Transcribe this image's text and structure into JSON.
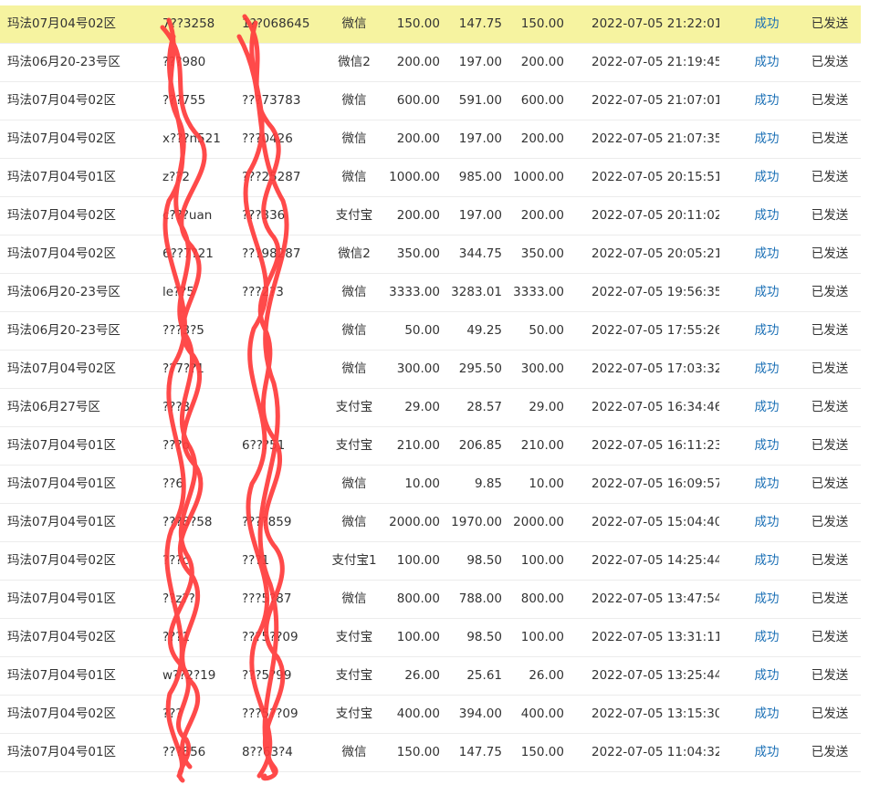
{
  "rows": [
    {
      "zone": "玛法07月04号02区",
      "user": "7??3258",
      "order": "1??068645",
      "pay": "微信",
      "amount": "150.00",
      "net": "147.75",
      "credit": "150.00",
      "time": "2022-07-05 21:22:01",
      "status": "成功",
      "sent": "已发送",
      "highlight": true
    },
    {
      "zone": "玛法06月20-23号区",
      "user": "???980",
      "order": "",
      "pay": "微信2",
      "amount": "200.00",
      "net": "197.00",
      "credit": "200.00",
      "time": "2022-07-05 21:19:45",
      "status": "成功",
      "sent": "已发送",
      "highlight": false
    },
    {
      "zone": "玛法07月04号02区",
      "user": "???755",
      "order": "???73783",
      "pay": "微信",
      "amount": "600.00",
      "net": "591.00",
      "credit": "600.00",
      "time": "2022-07-05 21:07:01",
      "status": "成功",
      "sent": "已发送",
      "highlight": false
    },
    {
      "zone": "玛法07月04号02区",
      "user": "x???n521",
      "order": "???0426",
      "pay": "微信",
      "amount": "200.00",
      "net": "197.00",
      "credit": "200.00",
      "time": "2022-07-05 21:07:35",
      "status": "成功",
      "sent": "已发送",
      "highlight": false
    },
    {
      "zone": "玛法07月04号01区",
      "user": "z??2",
      "order": "???25287",
      "pay": "微信",
      "amount": "1000.00",
      "net": "985.00",
      "credit": "1000.00",
      "time": "2022-07-05 20:15:51",
      "status": "成功",
      "sent": "已发送",
      "highlight": false
    },
    {
      "zone": "玛法07月04号02区",
      "user": "c???uan",
      "order": "???336",
      "pay": "支付宝",
      "amount": "200.00",
      "net": "197.00",
      "credit": "200.00",
      "time": "2022-07-05 20:11:02",
      "status": "成功",
      "sent": "已发送",
      "highlight": false
    },
    {
      "zone": "玛法07月04号02区",
      "user": "6??7?21",
      "order": "???98287",
      "pay": "微信2",
      "amount": "350.00",
      "net": "344.75",
      "credit": "350.00",
      "time": "2022-07-05 20:05:21",
      "status": "成功",
      "sent": "已发送",
      "highlight": false
    },
    {
      "zone": "玛法06月20-23号区",
      "user": "le??5",
      "order": "???2?3",
      "pay": "微信",
      "amount": "3333.00",
      "net": "3283.01",
      "credit": "3333.00",
      "time": "2022-07-05 19:56:35",
      "status": "成功",
      "sent": "已发送",
      "highlight": false
    },
    {
      "zone": "玛法06月20-23号区",
      "user": "???3?5",
      "order": "",
      "pay": "微信",
      "amount": "50.00",
      "net": "49.25",
      "credit": "50.00",
      "time": "2022-07-05 17:55:26",
      "status": "成功",
      "sent": "已发送",
      "highlight": false
    },
    {
      "zone": "玛法07月04号02区",
      "user": "??7??1",
      "order": "",
      "pay": "微信",
      "amount": "300.00",
      "net": "295.50",
      "credit": "300.00",
      "time": "2022-07-05 17:03:32",
      "status": "成功",
      "sent": "已发送",
      "highlight": false
    },
    {
      "zone": "玛法06月27号区",
      "user": "???3",
      "order": "",
      "pay": "支付宝",
      "amount": "29.00",
      "net": "28.57",
      "credit": "29.00",
      "time": "2022-07-05 16:34:46",
      "status": "成功",
      "sent": "已发送",
      "highlight": false
    },
    {
      "zone": "玛法07月04号01区",
      "user": "???o",
      "order": "6???51",
      "pay": "支付宝",
      "amount": "210.00",
      "net": "206.85",
      "credit": "210.00",
      "time": "2022-07-05 16:11:23",
      "status": "成功",
      "sent": "已发送",
      "highlight": false
    },
    {
      "zone": "玛法07月04号01区",
      "user": "??6",
      "order": "",
      "pay": "微信",
      "amount": "10.00",
      "net": "9.85",
      "credit": "10.00",
      "time": "2022-07-05 16:09:57",
      "status": "成功",
      "sent": "已发送",
      "highlight": false
    },
    {
      "zone": "玛法07月04号01区",
      "user": "???8?58",
      "order": "????859",
      "pay": "微信",
      "amount": "2000.00",
      "net": "1970.00",
      "credit": "2000.00",
      "time": "2022-07-05 15:04:40",
      "status": "成功",
      "sent": "已发送",
      "highlight": false
    },
    {
      "zone": "玛法07月04号02区",
      "user": "???c",
      "order": "???1",
      "pay": "支付宝1",
      "amount": "100.00",
      "net": "98.50",
      "credit": "100.00",
      "time": "2022-07-05 14:25:44",
      "status": "成功",
      "sent": "已发送",
      "highlight": false
    },
    {
      "zone": "玛法07月04号01区",
      "user": "??z??",
      "order": "???5?87",
      "pay": "微信",
      "amount": "800.00",
      "net": "788.00",
      "credit": "800.00",
      "time": "2022-07-05 13:47:54",
      "status": "成功",
      "sent": "已发送",
      "highlight": false
    },
    {
      "zone": "玛法07月04号02区",
      "user": "???1",
      "order": "???5??09",
      "pay": "支付宝",
      "amount": "100.00",
      "net": "98.50",
      "credit": "100.00",
      "time": "2022-07-05 13:31:11",
      "status": "成功",
      "sent": "已发送",
      "highlight": false
    },
    {
      "zone": "玛法07月04号01区",
      "user": "w??2?19",
      "order": "???5?99",
      "pay": "支付宝",
      "amount": "26.00",
      "net": "25.61",
      "credit": "26.00",
      "time": "2022-07-05 13:25:44",
      "status": "成功",
      "sent": "已发送",
      "highlight": false
    },
    {
      "zone": "玛法07月04号02区",
      "user": "???",
      "order": "???5??09",
      "pay": "支付宝",
      "amount": "400.00",
      "net": "394.00",
      "credit": "400.00",
      "time": "2022-07-05 13:15:30",
      "status": "成功",
      "sent": "已发送",
      "highlight": false
    },
    {
      "zone": "玛法07月04号01区",
      "user": "???856",
      "order": "8??63?4",
      "pay": "微信",
      "amount": "150.00",
      "net": "147.75",
      "credit": "150.00",
      "time": "2022-07-05 11:04:32",
      "status": "成功",
      "sent": "已发送",
      "highlight": false
    }
  ],
  "colors": {
    "highlight_row": "#f6f3a0",
    "status_link": "#1a6fb5",
    "redaction_scribble": "#ff3b3b",
    "row_divider": "#ececec"
  }
}
